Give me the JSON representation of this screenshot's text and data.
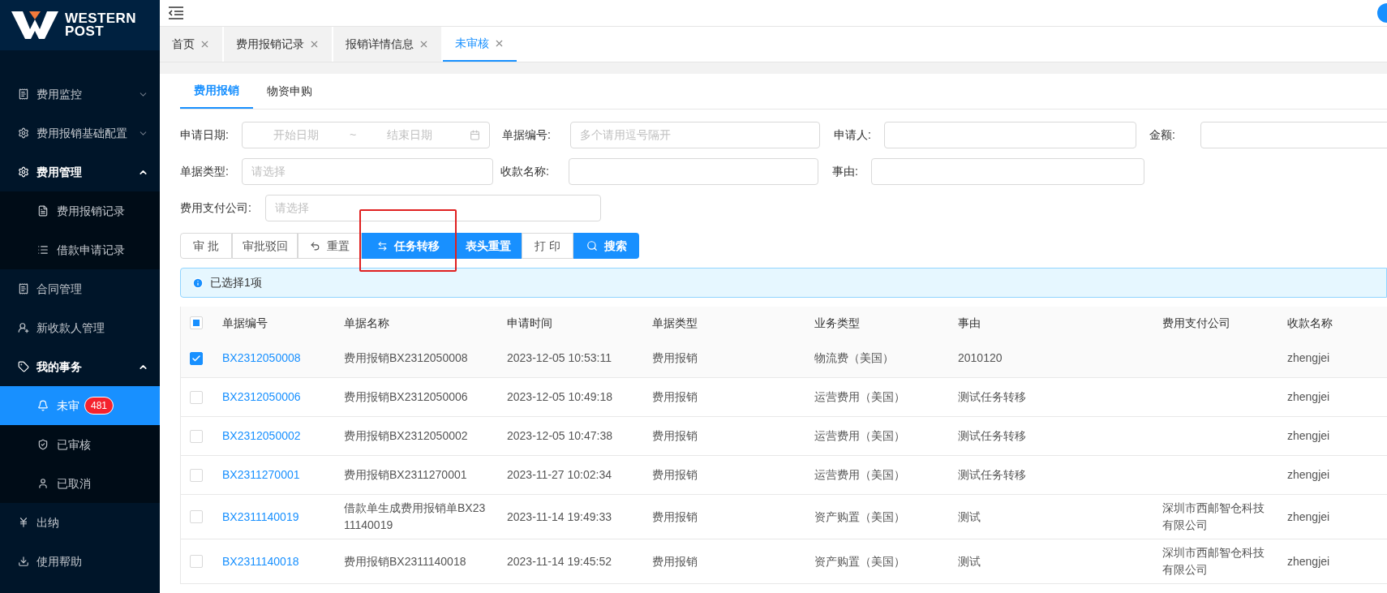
{
  "brand": {
    "line1": "WESTERN",
    "line2": "POST"
  },
  "menu": [
    {
      "label": "费用监控",
      "expandable": true,
      "expanded": false,
      "selected": false
    },
    {
      "label": "费用报销基础配置",
      "expandable": true,
      "expanded": false,
      "selected": false
    },
    {
      "label": "费用管理",
      "expandable": true,
      "expanded": true,
      "selected": false,
      "children": [
        {
          "label": "费用报销记录",
          "selected": false
        },
        {
          "label": "借款申请记录",
          "selected": false
        }
      ]
    },
    {
      "label": "合同管理",
      "expandable": false,
      "expanded": false,
      "selected": false
    },
    {
      "label": "新收款人管理",
      "expandable": false,
      "expanded": false,
      "selected": false
    },
    {
      "label": "我的事务",
      "expandable": true,
      "expanded": true,
      "selected": false,
      "children": [
        {
          "label": "未审",
          "selected": true,
          "badge": "481"
        },
        {
          "label": "已审核",
          "selected": false
        },
        {
          "label": "已取消",
          "selected": false
        }
      ]
    },
    {
      "label": "出纳",
      "expandable": false,
      "expanded": false,
      "selected": false
    },
    {
      "label": "使用帮助",
      "expandable": false,
      "expanded": false,
      "selected": false
    }
  ],
  "page_tabs": [
    {
      "label": "首页",
      "selected": false
    },
    {
      "label": "费用报销记录",
      "selected": false
    },
    {
      "label": "报销详情信息",
      "selected": false
    },
    {
      "label": "未审核",
      "selected": true
    }
  ],
  "sub_tabs": [
    {
      "label": "费用报销",
      "selected": true
    },
    {
      "label": "物资申购",
      "selected": false
    }
  ],
  "filters": {
    "date": {
      "label": "申请日期:",
      "start_placeholder": "开始日期",
      "separator": "~",
      "end_placeholder": "结束日期"
    },
    "doc_no": {
      "label": "单据编号:",
      "placeholder": "多个请用逗号隔开"
    },
    "applicant": {
      "label": "申请人:"
    },
    "amount": {
      "label": "金额:"
    },
    "doc_type": {
      "label": "单据类型:",
      "placeholder": "请选择"
    },
    "payee": {
      "label": "收款名称:"
    },
    "reason": {
      "label": "事由:"
    },
    "company": {
      "label": "费用支付公司:",
      "placeholder": "请选择"
    }
  },
  "actions": [
    {
      "label": "审 批",
      "kind": "plain"
    },
    {
      "label": "审批驳回",
      "kind": "plain"
    },
    {
      "label": "重置",
      "kind": "reset"
    },
    {
      "label": "任务转移",
      "kind": "transfer",
      "highlighted": true
    },
    {
      "label": "表头重置",
      "kind": "primary"
    },
    {
      "label": "打 印",
      "kind": "plain"
    },
    {
      "label": "搜索",
      "kind": "search"
    }
  ],
  "alert": {
    "text": "已选择1项"
  },
  "table": {
    "partially_checked": true,
    "columns": [
      "单据编号",
      "单据名称",
      "申请时间",
      "单据类型",
      "业务类型",
      "事由",
      "费用支付公司",
      "收款名称"
    ],
    "rows": [
      {
        "checked": true,
        "cells": [
          "BX2312050008",
          "费用报销BX2312050008",
          "2023-12-05 10:53:11",
          "费用报销",
          "物流费（美国）",
          "2010120",
          "",
          "zhengjei"
        ]
      },
      {
        "checked": false,
        "cells": [
          "BX2312050006",
          "费用报销BX2312050006",
          "2023-12-05 10:49:18",
          "费用报销",
          "运营费用（美国）",
          "测试任务转移",
          "",
          "zhengjei"
        ]
      },
      {
        "checked": false,
        "cells": [
          "BX2312050002",
          "费用报销BX2312050002",
          "2023-12-05 10:47:38",
          "费用报销",
          "运营费用（美国）",
          "测试任务转移",
          "",
          "zhengjei"
        ]
      },
      {
        "checked": false,
        "cells": [
          "BX2311270001",
          "费用报销BX2311270001",
          "2023-11-27 10:02:34",
          "费用报销",
          "运营费用（美国）",
          "测试任务转移",
          "",
          "zhengjei"
        ]
      },
      {
        "checked": false,
        "cells": [
          "BX2311140019",
          "借款单生成费用报销单BX2311140019",
          "2023-11-14 19:49:33",
          "费用报销",
          "资产购置（美国）",
          "测试",
          "深圳市西邮智仓科技有限公司",
          "zhengjei"
        ]
      },
      {
        "checked": false,
        "cells": [
          "BX2311140018",
          "费用报销BX2311140018",
          "2023-11-14 19:45:52",
          "费用报销",
          "资产购置（美国）",
          "测试",
          "深圳市西邮智仓科技有限公司",
          "zhengjei"
        ]
      }
    ]
  }
}
